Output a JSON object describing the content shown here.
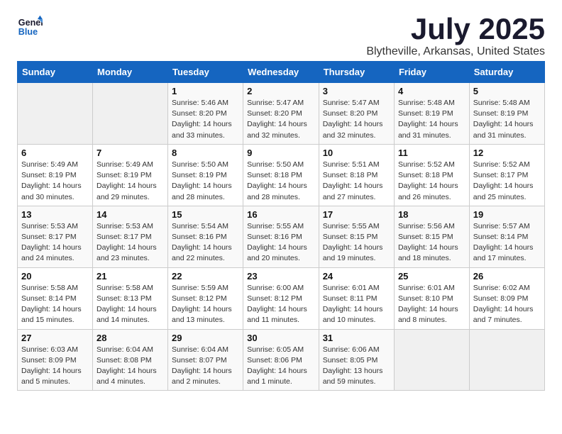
{
  "logo": {
    "line1": "General",
    "line2": "Blue"
  },
  "title": "July 2025",
  "location": "Blytheville, Arkansas, United States",
  "weekdays": [
    "Sunday",
    "Monday",
    "Tuesday",
    "Wednesday",
    "Thursday",
    "Friday",
    "Saturday"
  ],
  "weeks": [
    [
      {
        "day": "",
        "detail": ""
      },
      {
        "day": "",
        "detail": ""
      },
      {
        "day": "1",
        "detail": "Sunrise: 5:46 AM\nSunset: 8:20 PM\nDaylight: 14 hours\nand 33 minutes."
      },
      {
        "day": "2",
        "detail": "Sunrise: 5:47 AM\nSunset: 8:20 PM\nDaylight: 14 hours\nand 32 minutes."
      },
      {
        "day": "3",
        "detail": "Sunrise: 5:47 AM\nSunset: 8:20 PM\nDaylight: 14 hours\nand 32 minutes."
      },
      {
        "day": "4",
        "detail": "Sunrise: 5:48 AM\nSunset: 8:19 PM\nDaylight: 14 hours\nand 31 minutes."
      },
      {
        "day": "5",
        "detail": "Sunrise: 5:48 AM\nSunset: 8:19 PM\nDaylight: 14 hours\nand 31 minutes."
      }
    ],
    [
      {
        "day": "6",
        "detail": "Sunrise: 5:49 AM\nSunset: 8:19 PM\nDaylight: 14 hours\nand 30 minutes."
      },
      {
        "day": "7",
        "detail": "Sunrise: 5:49 AM\nSunset: 8:19 PM\nDaylight: 14 hours\nand 29 minutes."
      },
      {
        "day": "8",
        "detail": "Sunrise: 5:50 AM\nSunset: 8:19 PM\nDaylight: 14 hours\nand 28 minutes."
      },
      {
        "day": "9",
        "detail": "Sunrise: 5:50 AM\nSunset: 8:18 PM\nDaylight: 14 hours\nand 28 minutes."
      },
      {
        "day": "10",
        "detail": "Sunrise: 5:51 AM\nSunset: 8:18 PM\nDaylight: 14 hours\nand 27 minutes."
      },
      {
        "day": "11",
        "detail": "Sunrise: 5:52 AM\nSunset: 8:18 PM\nDaylight: 14 hours\nand 26 minutes."
      },
      {
        "day": "12",
        "detail": "Sunrise: 5:52 AM\nSunset: 8:17 PM\nDaylight: 14 hours\nand 25 minutes."
      }
    ],
    [
      {
        "day": "13",
        "detail": "Sunrise: 5:53 AM\nSunset: 8:17 PM\nDaylight: 14 hours\nand 24 minutes."
      },
      {
        "day": "14",
        "detail": "Sunrise: 5:53 AM\nSunset: 8:17 PM\nDaylight: 14 hours\nand 23 minutes."
      },
      {
        "day": "15",
        "detail": "Sunrise: 5:54 AM\nSunset: 8:16 PM\nDaylight: 14 hours\nand 22 minutes."
      },
      {
        "day": "16",
        "detail": "Sunrise: 5:55 AM\nSunset: 8:16 PM\nDaylight: 14 hours\nand 20 minutes."
      },
      {
        "day": "17",
        "detail": "Sunrise: 5:55 AM\nSunset: 8:15 PM\nDaylight: 14 hours\nand 19 minutes."
      },
      {
        "day": "18",
        "detail": "Sunrise: 5:56 AM\nSunset: 8:15 PM\nDaylight: 14 hours\nand 18 minutes."
      },
      {
        "day": "19",
        "detail": "Sunrise: 5:57 AM\nSunset: 8:14 PM\nDaylight: 14 hours\nand 17 minutes."
      }
    ],
    [
      {
        "day": "20",
        "detail": "Sunrise: 5:58 AM\nSunset: 8:14 PM\nDaylight: 14 hours\nand 15 minutes."
      },
      {
        "day": "21",
        "detail": "Sunrise: 5:58 AM\nSunset: 8:13 PM\nDaylight: 14 hours\nand 14 minutes."
      },
      {
        "day": "22",
        "detail": "Sunrise: 5:59 AM\nSunset: 8:12 PM\nDaylight: 14 hours\nand 13 minutes."
      },
      {
        "day": "23",
        "detail": "Sunrise: 6:00 AM\nSunset: 8:12 PM\nDaylight: 14 hours\nand 11 minutes."
      },
      {
        "day": "24",
        "detail": "Sunrise: 6:01 AM\nSunset: 8:11 PM\nDaylight: 14 hours\nand 10 minutes."
      },
      {
        "day": "25",
        "detail": "Sunrise: 6:01 AM\nSunset: 8:10 PM\nDaylight: 14 hours\nand 8 minutes."
      },
      {
        "day": "26",
        "detail": "Sunrise: 6:02 AM\nSunset: 8:09 PM\nDaylight: 14 hours\nand 7 minutes."
      }
    ],
    [
      {
        "day": "27",
        "detail": "Sunrise: 6:03 AM\nSunset: 8:09 PM\nDaylight: 14 hours\nand 5 minutes."
      },
      {
        "day": "28",
        "detail": "Sunrise: 6:04 AM\nSunset: 8:08 PM\nDaylight: 14 hours\nand 4 minutes."
      },
      {
        "day": "29",
        "detail": "Sunrise: 6:04 AM\nSunset: 8:07 PM\nDaylight: 14 hours\nand 2 minutes."
      },
      {
        "day": "30",
        "detail": "Sunrise: 6:05 AM\nSunset: 8:06 PM\nDaylight: 14 hours\nand 1 minute."
      },
      {
        "day": "31",
        "detail": "Sunrise: 6:06 AM\nSunset: 8:05 PM\nDaylight: 13 hours\nand 59 minutes."
      },
      {
        "day": "",
        "detail": ""
      },
      {
        "day": "",
        "detail": ""
      }
    ]
  ]
}
